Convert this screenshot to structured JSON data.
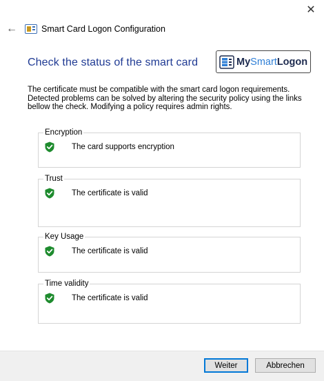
{
  "window": {
    "close_symbol": "✕",
    "back_symbol": "←",
    "title": "Smart Card Logon Configuration"
  },
  "page": {
    "heading": "Check the status of the smart card",
    "description": "The certificate must be compatible with the smart card logon requirements. Detected problems can be solved by altering the security policy using the links bellow the check. Modifying a policy requires admin rights."
  },
  "logo": {
    "my": "My",
    "smart": "Smart",
    "logon": "Logon"
  },
  "checks": [
    {
      "label": "Encryption",
      "status": "The card supports encryption",
      "icon": "green-shield-check-icon"
    },
    {
      "label": "Trust",
      "status": "The certificate is valid",
      "icon": "green-shield-check-icon"
    },
    {
      "label": "Key Usage",
      "status": "The certificate is valid",
      "icon": "green-shield-check-icon"
    },
    {
      "label": "Time validity",
      "status": "The certificate is valid",
      "icon": "green-shield-check-icon"
    }
  ],
  "buttons": {
    "next": "Weiter",
    "cancel": "Abbrechen"
  },
  "colors": {
    "heading": "#1f3a93",
    "shield": "#1e8b2e",
    "primary_border": "#0078d7"
  }
}
